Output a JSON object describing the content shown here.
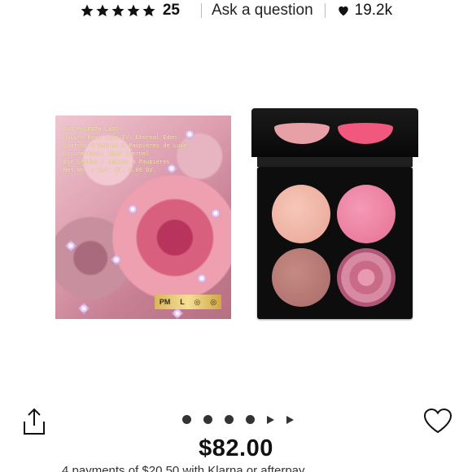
{
  "rating": {
    "stars": 5,
    "review_count": "25",
    "ask_label": "Ask a question",
    "likes": "19.2k"
  },
  "product": {
    "box_text_lines": [
      "PAT McGRATH LABS",
      "Divine Rose Luxe IV: Eternal Edén",
      "Quatuor d'Ombres à Paupières de Luxe",
      "Divine Rose: Eden Eternel",
      "Eye Shadow / Ombres à Paupières",
      "Net Wt. / Net. Wt. 0.06 Oz."
    ],
    "logo_plate": [
      "PM",
      "L",
      "◎",
      "◎"
    ]
  },
  "gallery": {
    "dot_count": 4,
    "arrow_count": 2
  },
  "price": "$82.00",
  "installments_text": "4 payments of $20.50 with Klarna or afterpay"
}
